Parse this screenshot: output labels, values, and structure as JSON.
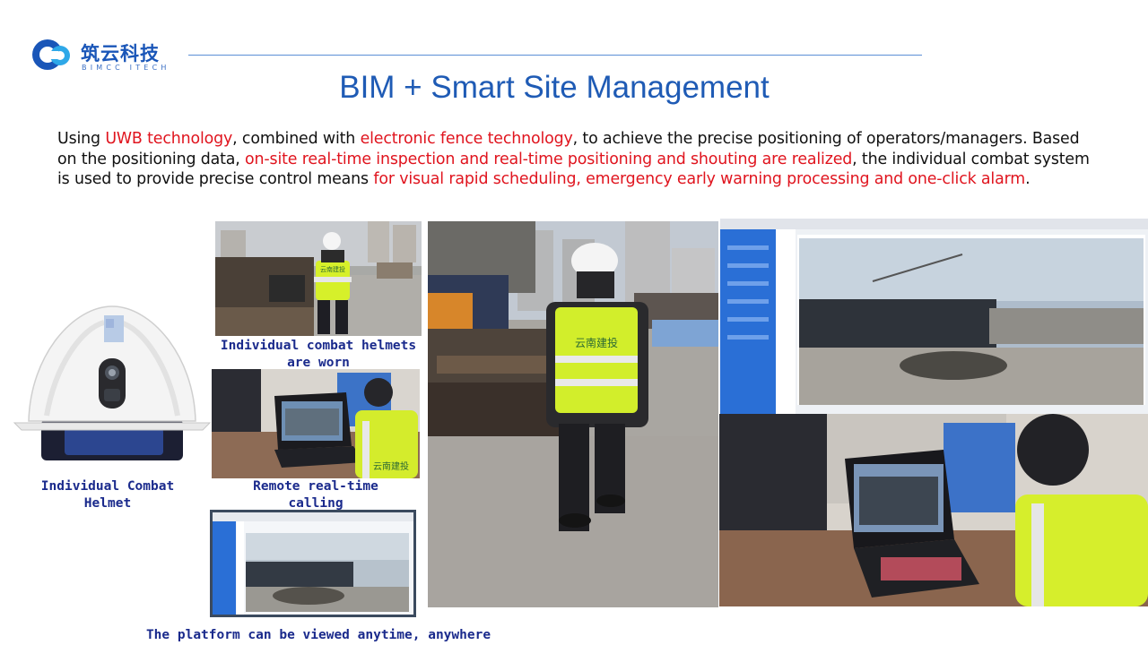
{
  "logo": {
    "cn": "筑云科技",
    "en": "BIMCC ITECH",
    "colors": {
      "primary": "#1a56b8",
      "accent": "#2ea8e8"
    }
  },
  "title": "BIM + Smart Site Management",
  "description": {
    "p1": "Using ",
    "h1": "UWB technology",
    "p2": ", combined with ",
    "h2": "electronic fence technology",
    "p3": ", to achieve the precise positioning of operators/managers. Based on the positioning data, ",
    "h3": "on-site real-time inspection and real-time positioning and shouting are realized",
    "p4": ", the individual combat system is used to provide precise control means ",
    "h4": "for visual rapid scheduling, emergency early warning processing and one-click alarm",
    "p5": ".",
    "highlight_color": "#e0141e"
  },
  "vest_text": "云南建投",
  "captions": {
    "helmets_worn": "Individual combat helmets are worn",
    "helmet": "Individual Combat Helmet",
    "remote_calling": "Remote real-time calling",
    "platform": "The platform can be viewed anytime, anywhere"
  }
}
